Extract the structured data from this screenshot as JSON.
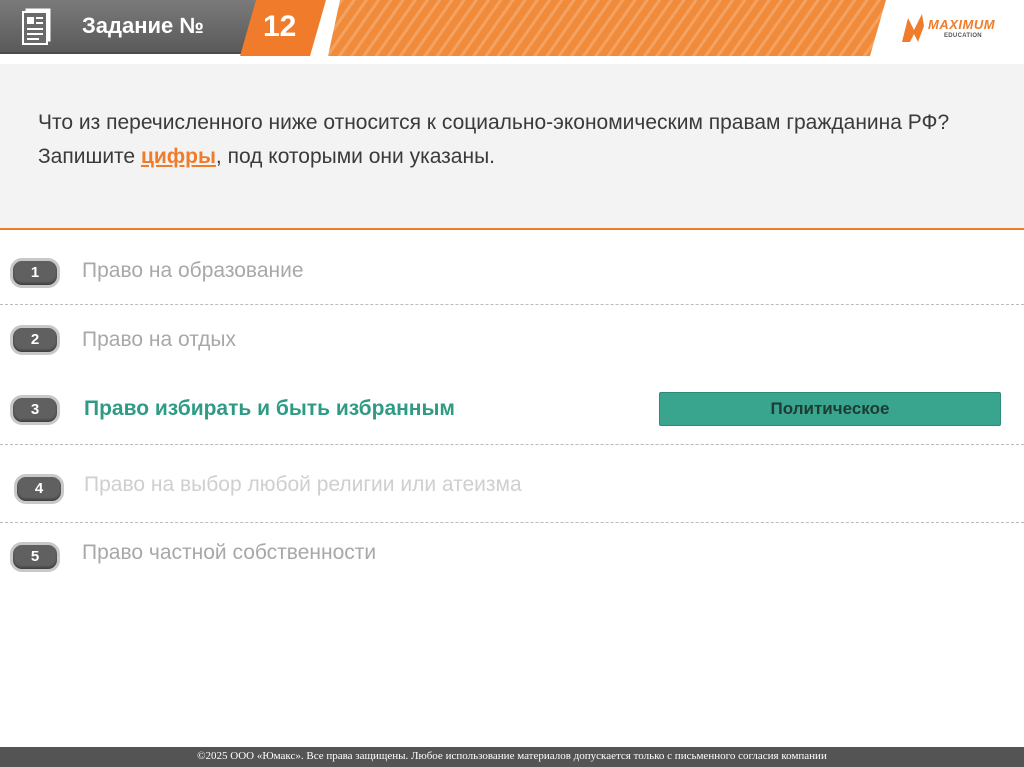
{
  "header": {
    "task_label": "Задание №",
    "task_number": "12",
    "logo_text": "MAXIMUM",
    "logo_subtext": "EDUCATION"
  },
  "question": {
    "part1": "Что из перечисленного ниже относится к социально-экономическим правам гражданина РФ? Запишите ",
    "highlight": "цифры",
    "part2": ", под которыми они указаны."
  },
  "options": [
    {
      "number": "1",
      "text": "Право на образование"
    },
    {
      "number": "2",
      "text": "Право на отдых"
    },
    {
      "number": "3",
      "text": "Право избирать и быть избранным",
      "tag": "Политическое"
    },
    {
      "number": "4",
      "text": "Право на выбор любой религии или атеизма"
    },
    {
      "number": "5",
      "text": "Право частной собственности"
    }
  ],
  "colors": {
    "accent": "#f07b2a",
    "highlight_green": "#2f9b84",
    "tag_bg": "#3aa58e"
  },
  "footer": {
    "copyright": "©2025 ООО «Юмакс». Все права защищены. Любое использование материалов допускается только с  письменного согласия компании"
  }
}
